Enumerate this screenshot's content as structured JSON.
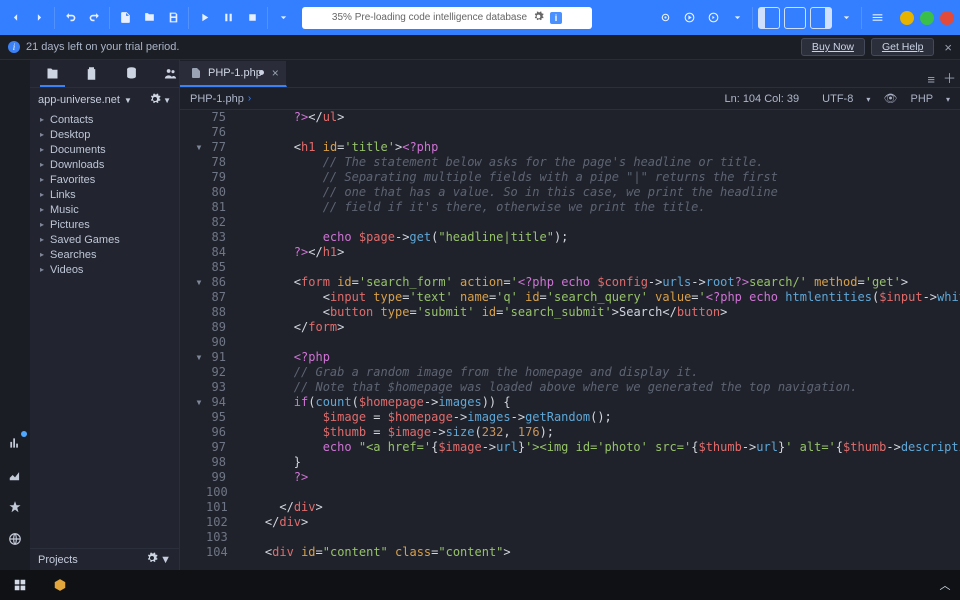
{
  "search": {
    "placeholder_text": "35% Pre-loading code intelligence database"
  },
  "trial": {
    "message": "21 days left on your trial period.",
    "buy_label": "Buy Now",
    "help_label": "Get Help",
    "buy_hotkey": "B",
    "help_hotkey": "H"
  },
  "sidebar": {
    "title": "app-universe.net",
    "items": [
      {
        "label": "Contacts"
      },
      {
        "label": "Desktop"
      },
      {
        "label": "Documents"
      },
      {
        "label": "Downloads"
      },
      {
        "label": "Favorites"
      },
      {
        "label": "Links"
      },
      {
        "label": "Music"
      },
      {
        "label": "Pictures"
      },
      {
        "label": "Saved Games"
      },
      {
        "label": "Searches"
      },
      {
        "label": "Videos"
      }
    ],
    "footer_label": "Projects"
  },
  "tabs": {
    "active": {
      "label": "PHP-1.php"
    }
  },
  "breadcrumb": {
    "file": "PHP-1.php"
  },
  "status": {
    "pos": "Ln: 104 Col: 39",
    "enc": "UTF-8",
    "lang": "PHP"
  },
  "code_lines": [
    {
      "n": 75,
      "fold": "",
      "html": "        <span class='tk-php'>?&gt;</span><span class='tk-p'>&lt;/</span><span class='tk-t'>ul</span><span class='tk-p'>&gt;</span>"
    },
    {
      "n": 76,
      "fold": "",
      "html": ""
    },
    {
      "n": 77,
      "fold": "▾",
      "html": "        <span class='tk-p'>&lt;</span><span class='tk-t'>h1</span> <span class='tk-a'>id</span><span class='tk-p'>=</span><span class='tk-s'>'title'</span><span class='tk-p'>&gt;</span><span class='tk-php'>&lt;?php</span>"
    },
    {
      "n": 78,
      "fold": "",
      "html": "            <span class='tk-c'>// The statement below asks for the page's headline or title.</span>"
    },
    {
      "n": 79,
      "fold": "",
      "html": "            <span class='tk-c'>// Separating multiple fields with a pipe \"|\" returns the first</span>"
    },
    {
      "n": 80,
      "fold": "",
      "html": "            <span class='tk-c'>// one that has a value. So in this case, we print the headline</span>"
    },
    {
      "n": 81,
      "fold": "",
      "html": "            <span class='tk-c'>// field if it's there, otherwise we print the title.</span>"
    },
    {
      "n": 82,
      "fold": "",
      "html": ""
    },
    {
      "n": 83,
      "fold": "",
      "html": "            <span class='tk-k'>echo</span> <span class='tk-v'>$page</span><span class='tk-p'>-&gt;</span><span class='tk-f'>get</span><span class='tk-p'>(</span><span class='tk-s'>\"headline|title\"</span><span class='tk-p'>);</span>"
    },
    {
      "n": 84,
      "fold": "",
      "html": "        <span class='tk-php'>?&gt;</span><span class='tk-p'>&lt;/</span><span class='tk-t'>h1</span><span class='tk-p'>&gt;</span>"
    },
    {
      "n": 85,
      "fold": "",
      "html": ""
    },
    {
      "n": 86,
      "fold": "▾",
      "html": "        <span class='tk-p'>&lt;</span><span class='tk-t'>form</span> <span class='tk-a'>id</span><span class='tk-p'>=</span><span class='tk-s'>'search_form'</span> <span class='tk-a'>action</span><span class='tk-p'>=</span><span class='tk-s'>'</span><span class='tk-php'>&lt;?php</span> <span class='tk-k'>echo</span> <span class='tk-v'>$config</span><span class='tk-p'>-&gt;</span><span class='tk-f'>urls</span><span class='tk-p'>-&gt;</span><span class='tk-f'>root</span><span class='tk-php'>?&gt;</span><span class='tk-s'>search/'</span> <span class='tk-a'>method</span><span class='tk-p'>=</span><span class='tk-s'>'get'</span><span class='tk-p'>&gt;</span>"
    },
    {
      "n": 87,
      "fold": "",
      "html": "            <span class='tk-p'>&lt;</span><span class='tk-t'>input</span> <span class='tk-a'>type</span><span class='tk-p'>=</span><span class='tk-s'>'text'</span> <span class='tk-a'>name</span><span class='tk-p'>=</span><span class='tk-s'>'q'</span> <span class='tk-a'>id</span><span class='tk-p'>=</span><span class='tk-s'>'search_query'</span> <span class='tk-a'>value</span><span class='tk-p'>=</span><span class='tk-s'>'</span><span class='tk-php'>&lt;?php</span> <span class='tk-k'>echo</span> <span class='tk-f'>htmlentities</span><span class='tk-p'>(</span><span class='tk-v'>$input</span><span class='tk-p'>-&gt;</span><span class='tk-f'>whitelist</span><span class='tk-p'>(</span><span class='tk-s'>'q'</span><span class='tk-p'>)</span><span class='tk-p'>,</span> <span class='tk-f'>EN</span>"
    },
    {
      "n": 88,
      "fold": "",
      "html": "            <span class='tk-p'>&lt;</span><span class='tk-t'>button</span> <span class='tk-a'>type</span><span class='tk-p'>=</span><span class='tk-s'>'submit'</span> <span class='tk-a'>id</span><span class='tk-p'>=</span><span class='tk-s'>'search_submit'</span><span class='tk-p'>&gt;</span>Search<span class='tk-p'>&lt;/</span><span class='tk-t'>button</span><span class='tk-p'>&gt;</span>"
    },
    {
      "n": 89,
      "fold": "",
      "html": "        <span class='tk-p'>&lt;/</span><span class='tk-t'>form</span><span class='tk-p'>&gt;</span>"
    },
    {
      "n": 90,
      "fold": "",
      "html": ""
    },
    {
      "n": 91,
      "fold": "▾",
      "html": "        <span class='tk-php'>&lt;?php</span>"
    },
    {
      "n": 92,
      "fold": "",
      "html": "        <span class='tk-c'>// Grab a random image from the homepage and display it.</span>"
    },
    {
      "n": 93,
      "fold": "",
      "html": "        <span class='tk-c'>// Note that $homepage was loaded above where we generated the top navigation.</span>"
    },
    {
      "n": 94,
      "fold": "▾",
      "html": "        <span class='tk-k'>if</span><span class='tk-p'>(</span><span class='tk-f'>count</span><span class='tk-p'>(</span><span class='tk-v'>$homepage</span><span class='tk-p'>-&gt;</span><span class='tk-f'>images</span><span class='tk-p'>))</span> <span class='tk-p'>{</span>"
    },
    {
      "n": 95,
      "fold": "",
      "html": "            <span class='tk-v'>$image</span> <span class='tk-p'>=</span> <span class='tk-v'>$homepage</span><span class='tk-p'>-&gt;</span><span class='tk-f'>images</span><span class='tk-p'>-&gt;</span><span class='tk-f'>getRandom</span><span class='tk-p'>();</span>"
    },
    {
      "n": 96,
      "fold": "",
      "html": "            <span class='tk-v'>$thumb</span> <span class='tk-p'>=</span> <span class='tk-v'>$image</span><span class='tk-p'>-&gt;</span><span class='tk-f'>size</span><span class='tk-p'>(</span><span class='tk-n'>232</span><span class='tk-p'>,</span> <span class='tk-n'>176</span><span class='tk-p'>);</span>"
    },
    {
      "n": 97,
      "fold": "",
      "html": "            <span class='tk-k'>echo</span> <span class='tk-s'>\"&lt;a href='</span><span class='tk-p'>{</span><span class='tk-v'>$image</span><span class='tk-p'>-&gt;</span><span class='tk-f'>url</span><span class='tk-p'>}</span><span class='tk-s'>'&gt;&lt;img id='photo' src='</span><span class='tk-p'>{</span><span class='tk-v'>$thumb</span><span class='tk-p'>-&gt;</span><span class='tk-f'>url</span><span class='tk-p'>}</span><span class='tk-s'>' alt='</span><span class='tk-p'>{</span><span class='tk-v'>$thumb</span><span class='tk-p'>-&gt;</span><span class='tk-f'>description</span><span class='tk-p'>}</span><span class='tk-s'>' width='</span><span class='tk-p'>{</span><span class='tk-v'>$</span>"
    },
    {
      "n": 98,
      "fold": "",
      "html": "        <span class='tk-p'>}</span>"
    },
    {
      "n": 99,
      "fold": "",
      "html": "        <span class='tk-php'>?&gt;</span>"
    },
    {
      "n": 100,
      "fold": "",
      "html": ""
    },
    {
      "n": 101,
      "fold": "",
      "html": "      <span class='tk-p'>&lt;/</span><span class='tk-t'>div</span><span class='tk-p'>&gt;</span>"
    },
    {
      "n": 102,
      "fold": "",
      "html": "    <span class='tk-p'>&lt;/</span><span class='tk-t'>div</span><span class='tk-p'>&gt;</span>"
    },
    {
      "n": 103,
      "fold": "",
      "html": ""
    },
    {
      "n": 104,
      "fold": "",
      "html": "    <span class='tk-p'>&lt;</span><span class='tk-t'>div</span> <span class='tk-a'>id</span><span class='tk-p'>=</span><span class='tk-s'>\"content\"</span> <span class='tk-a'>class</span><span class='tk-p'>=</span><span class='tk-s'>\"content\"</span><span class='tk-p'>&gt;</span>"
    }
  ]
}
